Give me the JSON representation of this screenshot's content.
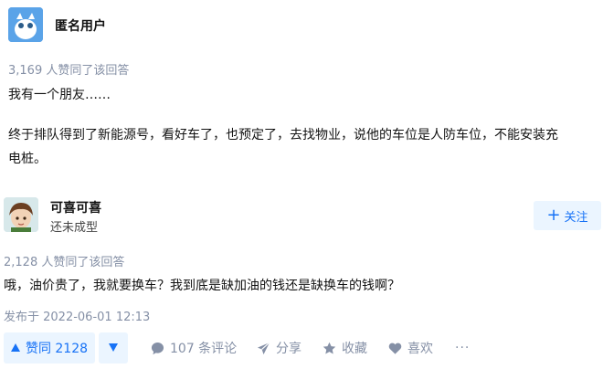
{
  "top_answer": {
    "author": "匿名用户",
    "likes_text": "3,169 人赞同了该回答",
    "paragraph1": "我有一个朋友……",
    "paragraph2_line1": "终于排队得到了新能源号，看好车了，也预定了，去找物业，说他的车位是人防车位，不能安装充",
    "paragraph2_line2": "电桩。"
  },
  "second_answer": {
    "author": "可喜可喜",
    "headline": "还未成型",
    "follow_label": "关注",
    "likes_text": "2,128 人赞同了该回答",
    "content": "哦，油价贵了，我就要换车？我到底是缺加油的钱还是缺换车的钱啊？",
    "published": "发布于 2022-06-01 12:13"
  },
  "actions": {
    "vote_up_label": "赞同 2128",
    "comments_label": "107 条评论",
    "share_label": "分享",
    "collect_label": "收藏",
    "like_label": "喜欢",
    "more_label": "···"
  },
  "colors": {
    "accent": "#1772f6",
    "accent_bg": "#ebf5ff",
    "meta": "#8590a6"
  }
}
